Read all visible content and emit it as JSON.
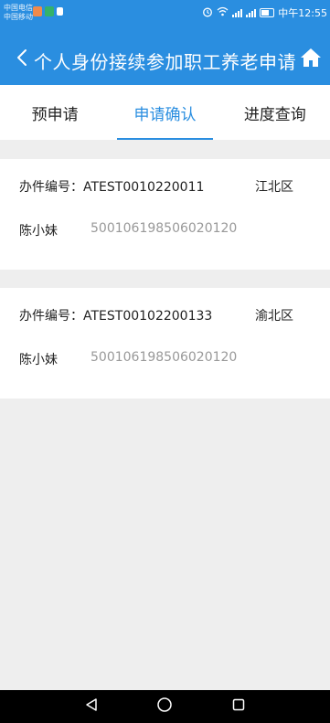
{
  "status_bar": {
    "carrier_line1": "中国电信",
    "carrier_line2": "中国移动",
    "time": "中午12:55",
    "icons": [
      "alarm-icon",
      "wifi-icon",
      "signal-icon",
      "battery-icon"
    ]
  },
  "header": {
    "title": "个人身份接续参加职工养老申请",
    "back_icon": "chevron-left-icon",
    "home_icon": "home-icon",
    "background_color": "#2a8ee0"
  },
  "tabs": [
    {
      "label": "预申请",
      "active": false
    },
    {
      "label": "申请确认",
      "active": true
    },
    {
      "label": "进度查询",
      "active": false
    }
  ],
  "records": [
    {
      "case_label": "办件编号：ATEST0010220011",
      "district": "江北区",
      "name": "陈小妹",
      "id_number": "500106198506020120"
    },
    {
      "case_label": "办件编号：ATEST00102200133",
      "district": "渝北区",
      "name": "陈小妹",
      "id_number": "500106198506020120"
    }
  ],
  "nav_bar": {
    "buttons": [
      "back-triangle-icon",
      "home-circle-icon",
      "recents-square-icon"
    ]
  }
}
